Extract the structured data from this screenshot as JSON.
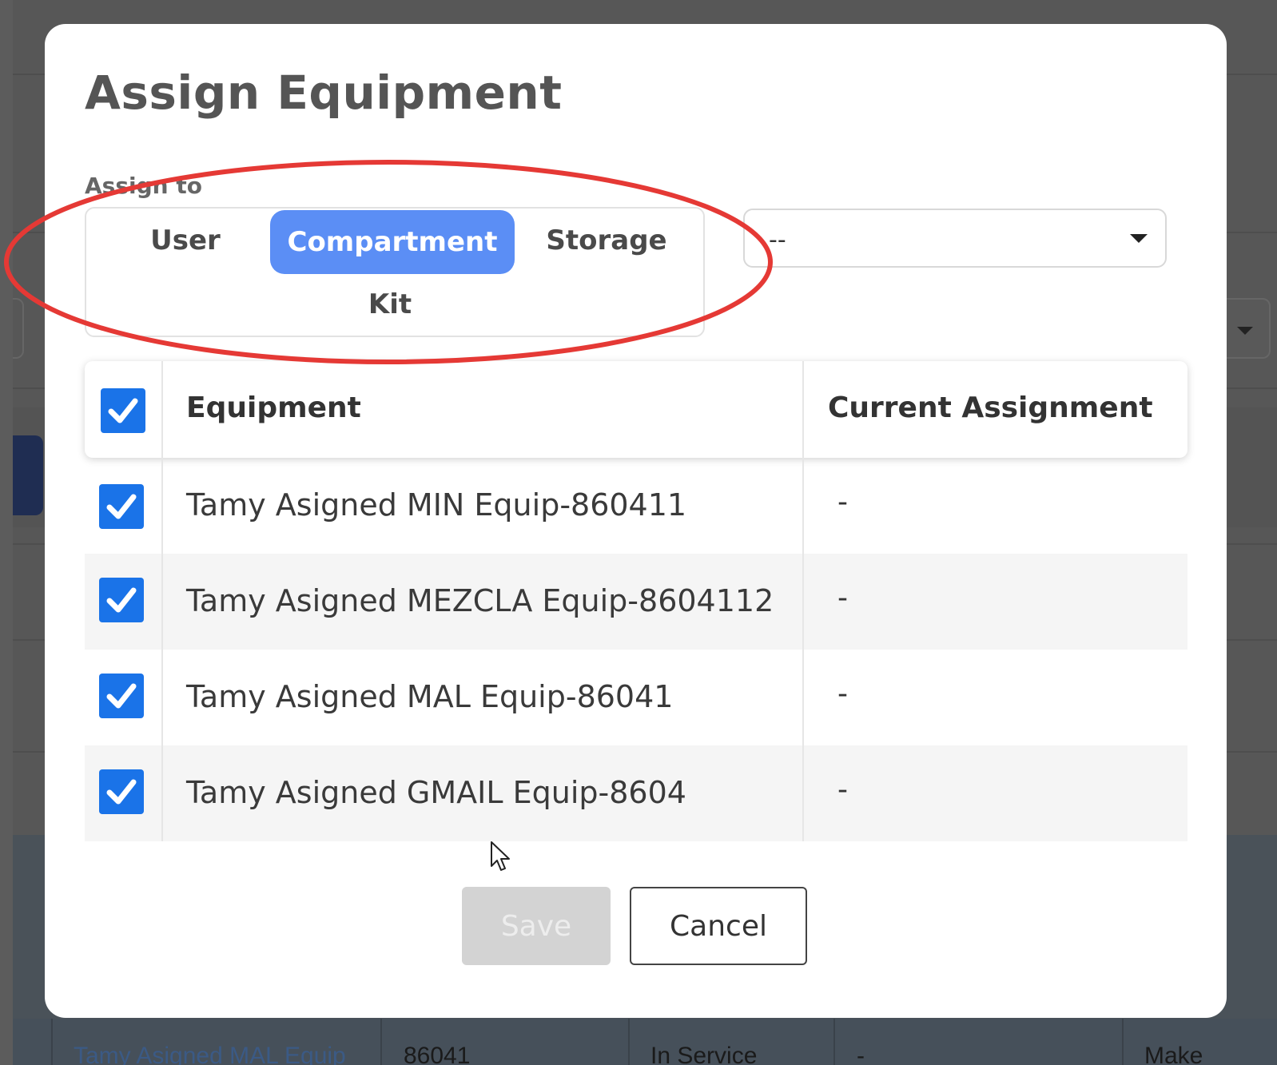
{
  "modal": {
    "title": "Assign Equipment",
    "assign_to_label": "Assign to",
    "assign_options": [
      "User",
      "Compartment",
      "Storage",
      "Kit"
    ],
    "selected_option": "Compartment",
    "target_select_value": "--",
    "table": {
      "headers": {
        "equipment": "Equipment",
        "current_assignment": "Current Assignment"
      },
      "rows": [
        {
          "equipment": "Tamy Asigned MIN Equip-860411",
          "current_assignment": "-",
          "checked": true
        },
        {
          "equipment": "Tamy Asigned MEZCLA Equip-8604112",
          "current_assignment": "-",
          "checked": true
        },
        {
          "equipment": "Tamy Asigned MAL Equip-86041",
          "current_assignment": "-",
          "checked": true
        },
        {
          "equipment": "Tamy Asigned GMAIL Equip-8604",
          "current_assignment": "-",
          "checked": true
        }
      ],
      "select_all_checked": true
    },
    "save_label": "Save",
    "cancel_label": "Cancel"
  },
  "background_row": {
    "name": "Tamy Asigned MAL Equip",
    "id": "86041",
    "status": "In Service",
    "assignment": "-",
    "action": "Make"
  },
  "colors": {
    "accent": "#5b8ef5",
    "checkbox": "#1a73e8",
    "annotation": "#e53935"
  }
}
